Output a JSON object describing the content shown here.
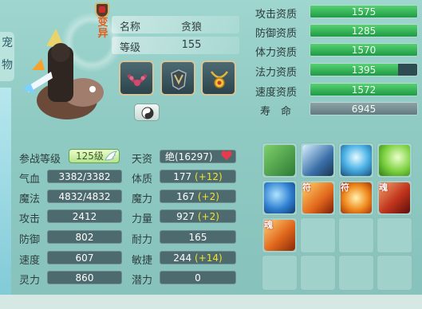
{
  "side_tabs": [
    "宠",
    "物"
  ],
  "pet": {
    "status_label": "变异",
    "name_label": "名称",
    "name": "贪狼",
    "level_label": "等级",
    "level": "155"
  },
  "equipment": [
    {
      "icon": "collar-equip-icon"
    },
    {
      "icon": "armor-equip-icon"
    },
    {
      "icon": "amulet-equip-icon"
    }
  ],
  "aptitudes": [
    {
      "label": "攻击资质",
      "value": "1575",
      "fill": 1.0,
      "color": "#2fae52"
    },
    {
      "label": "防御资质",
      "value": "1285",
      "fill": 1.0,
      "color": "#2fae52"
    },
    {
      "label": "体力资质",
      "value": "1570",
      "fill": 1.0,
      "color": "#2fae52"
    },
    {
      "label": "法力资质",
      "value": "1395",
      "fill": 0.82,
      "color": "#2fae52"
    },
    {
      "label": "速度资质",
      "value": "1572",
      "fill": 1.0,
      "color": "#2fae52"
    },
    {
      "label": "寿　命",
      "value": "6945",
      "fill": 1.0,
      "color": "#6f878c"
    }
  ],
  "battle_level": {
    "label": "参战等级",
    "value": "125级"
  },
  "talent": {
    "label": "天资",
    "value": "绝(16297)"
  },
  "left_stats": [
    {
      "label": "气血",
      "value": "3382/3382"
    },
    {
      "label": "魔法",
      "value": "4832/4832"
    },
    {
      "label": "攻击",
      "value": "2412"
    },
    {
      "label": "防御",
      "value": "802"
    },
    {
      "label": "速度",
      "value": "607"
    },
    {
      "label": "灵力",
      "value": "860"
    }
  ],
  "right_stats": [
    {
      "label": "体质",
      "value": "177",
      "bonus": "(+12)"
    },
    {
      "label": "魔力",
      "value": "167",
      "bonus": "(+2)"
    },
    {
      "label": "力量",
      "value": "927",
      "bonus": "(+2)"
    },
    {
      "label": "耐力",
      "value": "165",
      "bonus": ""
    },
    {
      "label": "敏捷",
      "value": "244",
      "bonus": "(+14)"
    },
    {
      "label": "潜力",
      "value": "0",
      "bonus": ""
    }
  ],
  "skills": [
    {
      "icon": "frog-skill-icon",
      "tag": ""
    },
    {
      "icon": "toad-lightning-skill-icon",
      "tag": ""
    },
    {
      "icon": "blue-light-skill-icon",
      "tag": ""
    },
    {
      "icon": "green-heart-skill-icon",
      "tag": ""
    },
    {
      "icon": "blue-swirl-skill-icon",
      "tag": ""
    },
    {
      "icon": "sword-skill-icon",
      "tag": "符"
    },
    {
      "icon": "fire-ring-skill-icon",
      "tag": "符"
    },
    {
      "icon": "red-beast-skill-icon",
      "tag": "魂"
    },
    {
      "icon": "orange-slash-skill-icon",
      "tag": "魂"
    }
  ]
}
